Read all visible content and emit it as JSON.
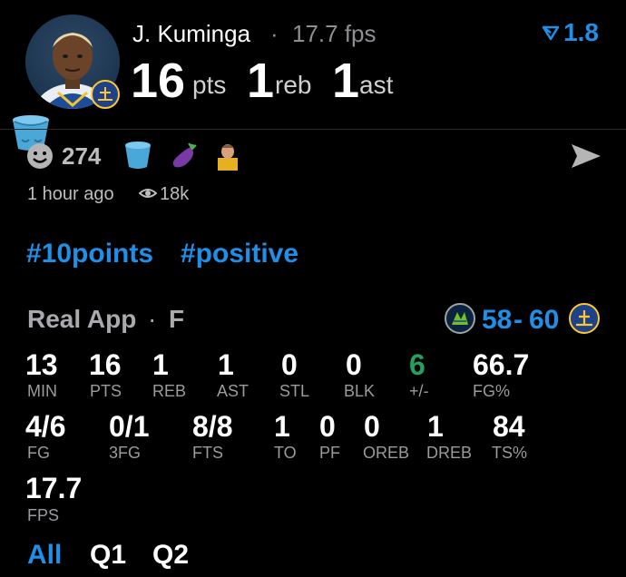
{
  "player": {
    "name": "J. Kuminga",
    "separator": "·",
    "fps_label": "17.7 fps",
    "rating": "1.8"
  },
  "headline": {
    "pts_value": "16",
    "pts_label": "pts",
    "reb_value": "1",
    "reb_label": "reb",
    "ast_value": "1",
    "ast_label": "ast"
  },
  "reactions": {
    "count": "274",
    "time": "1 hour ago",
    "views": "18k"
  },
  "tags": [
    "#10points",
    "#positive"
  ],
  "game": {
    "app": "Real App",
    "separator": "·",
    "position": "F",
    "score_left": "58",
    "score_dash": "-",
    "score_right": "60"
  },
  "stats_row1": [
    {
      "value": "13",
      "label": "MIN"
    },
    {
      "value": "16",
      "label": "PTS"
    },
    {
      "value": "1",
      "label": "REB"
    },
    {
      "value": "1",
      "label": "AST"
    },
    {
      "value": "0",
      "label": "STL"
    },
    {
      "value": "0",
      "label": "BLK"
    },
    {
      "value": "6",
      "label": "+/-"
    },
    {
      "value": "66.7",
      "label": "FG%"
    }
  ],
  "stats_row2": [
    {
      "value": "4/6",
      "label": "FG"
    },
    {
      "value": "0/1",
      "label": "3FG"
    },
    {
      "value": "8/8",
      "label": "FTS"
    },
    {
      "value": "1",
      "label": "TO"
    },
    {
      "value": "0",
      "label": "PF"
    },
    {
      "value": "0",
      "label": "OREB"
    },
    {
      "value": "1",
      "label": "DREB"
    },
    {
      "value": "84",
      "label": "TS%"
    }
  ],
  "stats_row3": [
    {
      "value": "17.7",
      "label": "FPS"
    }
  ],
  "periods": [
    "All",
    "Q1",
    "Q2"
  ],
  "colors": {
    "accent": "#1f8fe8",
    "positive": "#25a060",
    "muted": "#9a9a9f",
    "background": "#000000"
  },
  "icons": [
    "player-avatar",
    "bucket-icon",
    "warriors-logo-icon",
    "smile-icon",
    "eggplant-icon",
    "player-emoji-icon",
    "send-icon",
    "eye-icon",
    "timberwolves-logo-icon",
    "rating-icon"
  ]
}
